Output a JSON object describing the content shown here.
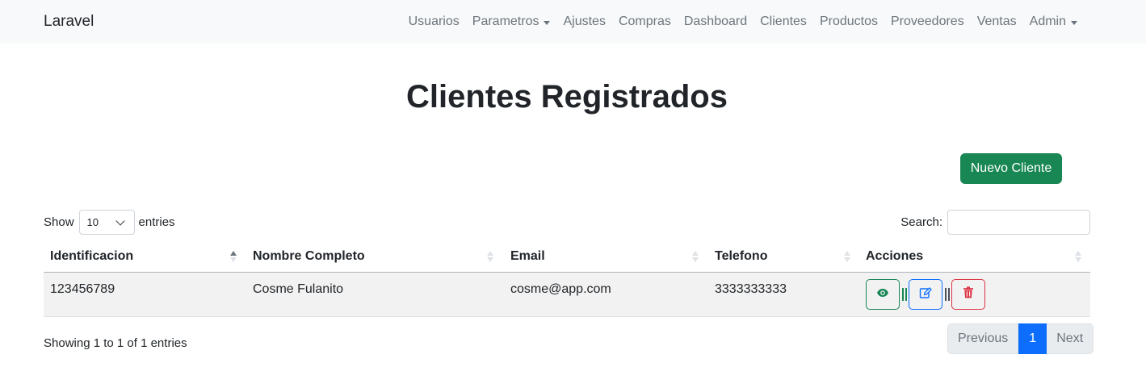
{
  "navbar": {
    "brand": "Laravel",
    "items": [
      {
        "label": "Usuarios"
      },
      {
        "label": "Parametros"
      },
      {
        "label": "Ajustes"
      },
      {
        "label": "Compras"
      },
      {
        "label": "Dashboard"
      },
      {
        "label": "Clientes"
      },
      {
        "label": "Productos"
      },
      {
        "label": "Proveedores"
      },
      {
        "label": "Ventas"
      },
      {
        "label": "Admin"
      }
    ]
  },
  "page": {
    "title": "Clientes Registrados",
    "new_button": "Nuevo Cliente"
  },
  "table_controls": {
    "show_label": "Show",
    "length_value": "10",
    "entries_label": "entries",
    "search_label": "Search:",
    "search_value": ""
  },
  "table": {
    "columns": [
      "Identificacion",
      "Nombre Completo",
      "Email",
      "Telefono",
      "Acciones"
    ],
    "rows": [
      {
        "identificacion": "123456789",
        "nombre": "Cosme Fulanito",
        "email": "cosme@app.com",
        "telefono": "3333333333"
      }
    ]
  },
  "actions": {
    "view_icon": "eye-icon",
    "edit_icon": "edit-icon",
    "delete_icon": "trash-icon"
  },
  "footer": {
    "info": "Showing 1 to 1 of 1 entries",
    "previous": "Previous",
    "current_page": "1",
    "next": "Next"
  },
  "colors": {
    "success": "#198754",
    "primary": "#0d6efd",
    "danger": "#dc3545",
    "navbar_bg": "#f8f9fa"
  }
}
